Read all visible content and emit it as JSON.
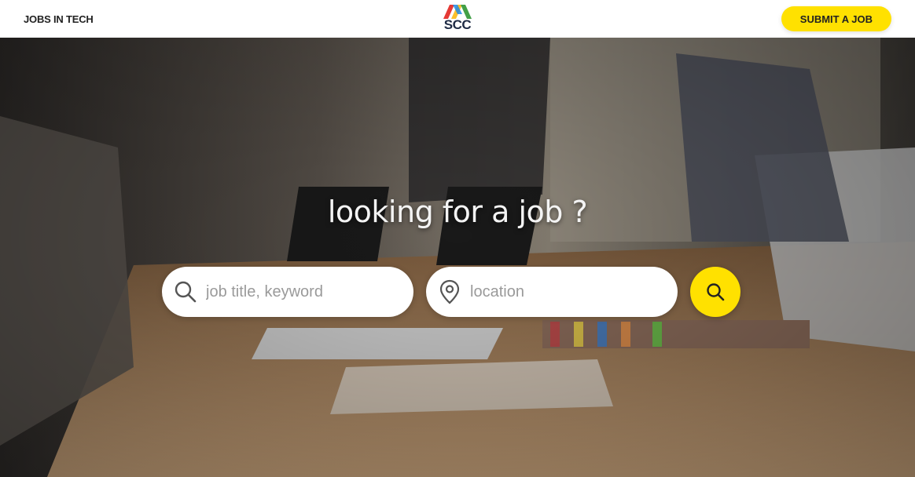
{
  "header": {
    "nav_link": "JOBS IN TECH",
    "logo_text": "SCC",
    "submit_label": "SUBMIT A JOB"
  },
  "hero": {
    "headline": "looking for a job ?",
    "search": {
      "keyword_placeholder": "job title, keyword",
      "keyword_value": "",
      "location_placeholder": "location",
      "location_value": ""
    }
  },
  "icons": {
    "keyword": "search-icon",
    "location": "map-pin-icon",
    "submit": "search-icon"
  },
  "colors": {
    "accent": "#ffe100",
    "logo_red": "#e53935",
    "logo_yellow": "#fbc02d",
    "logo_green": "#43a047",
    "logo_text": "#1e2a44"
  }
}
